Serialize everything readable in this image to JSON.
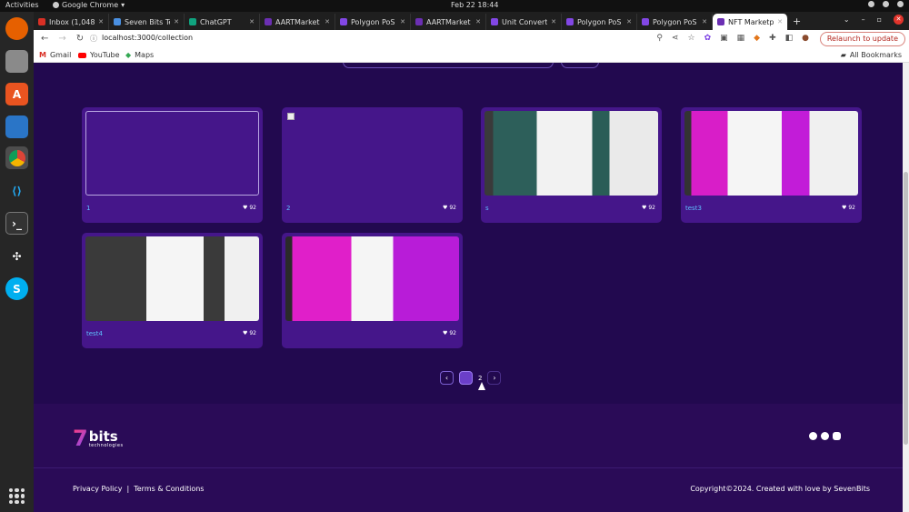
{
  "os": {
    "activities": "Activities",
    "app_name": "Google Chrome",
    "clock": "Feb 22  18:44"
  },
  "tabs": [
    {
      "label": "Inbox (1,048)",
      "color": "#d93025"
    },
    {
      "label": "Seven Bits Te",
      "color": "#4a90e2"
    },
    {
      "label": "ChatGPT",
      "color": "#10a37f"
    },
    {
      "label": "AARTMarket",
      "color": "#6b2fb3"
    },
    {
      "label": "Polygon PoS",
      "color": "#8247e5"
    },
    {
      "label": "AARTMarket",
      "color": "#6b2fb3"
    },
    {
      "label": "Unit Converte",
      "color": "#8247e5"
    },
    {
      "label": "Polygon PoS",
      "color": "#8247e5"
    },
    {
      "label": "Polygon PoS",
      "color": "#8247e5"
    },
    {
      "label": "NFT Marketp",
      "color": "#6b2fb3"
    }
  ],
  "address": {
    "url": "localhost:3000/collection",
    "relaunch": "Relaunch to update"
  },
  "bookmarks": {
    "gmail": "Gmail",
    "youtube": "YouTube",
    "maps": "Maps",
    "all": "All Bookmarks"
  },
  "cards": [
    {
      "name": "1",
      "likes": "92"
    },
    {
      "name": "2",
      "likes": "92"
    },
    {
      "name": "s",
      "likes": "92"
    },
    {
      "name": "test3",
      "likes": "92"
    },
    {
      "name": "test4",
      "likes": "92"
    },
    {
      "name": "",
      "likes": "92"
    }
  ],
  "pagination": {
    "prev": "‹",
    "next": "›",
    "page2": "2"
  },
  "footer": {
    "logo_seven": "7",
    "logo_bits": "bits",
    "logo_sub": "technologies",
    "privacy": "Privacy Policy",
    "sep": "|",
    "terms": "Terms & Conditions",
    "copyright": "Copyright©2024. Created with love by SevenBits"
  },
  "colors": {
    "page_bg": "#22094f",
    "card_bg": "#45168a",
    "accent": "#5ec0ff"
  }
}
